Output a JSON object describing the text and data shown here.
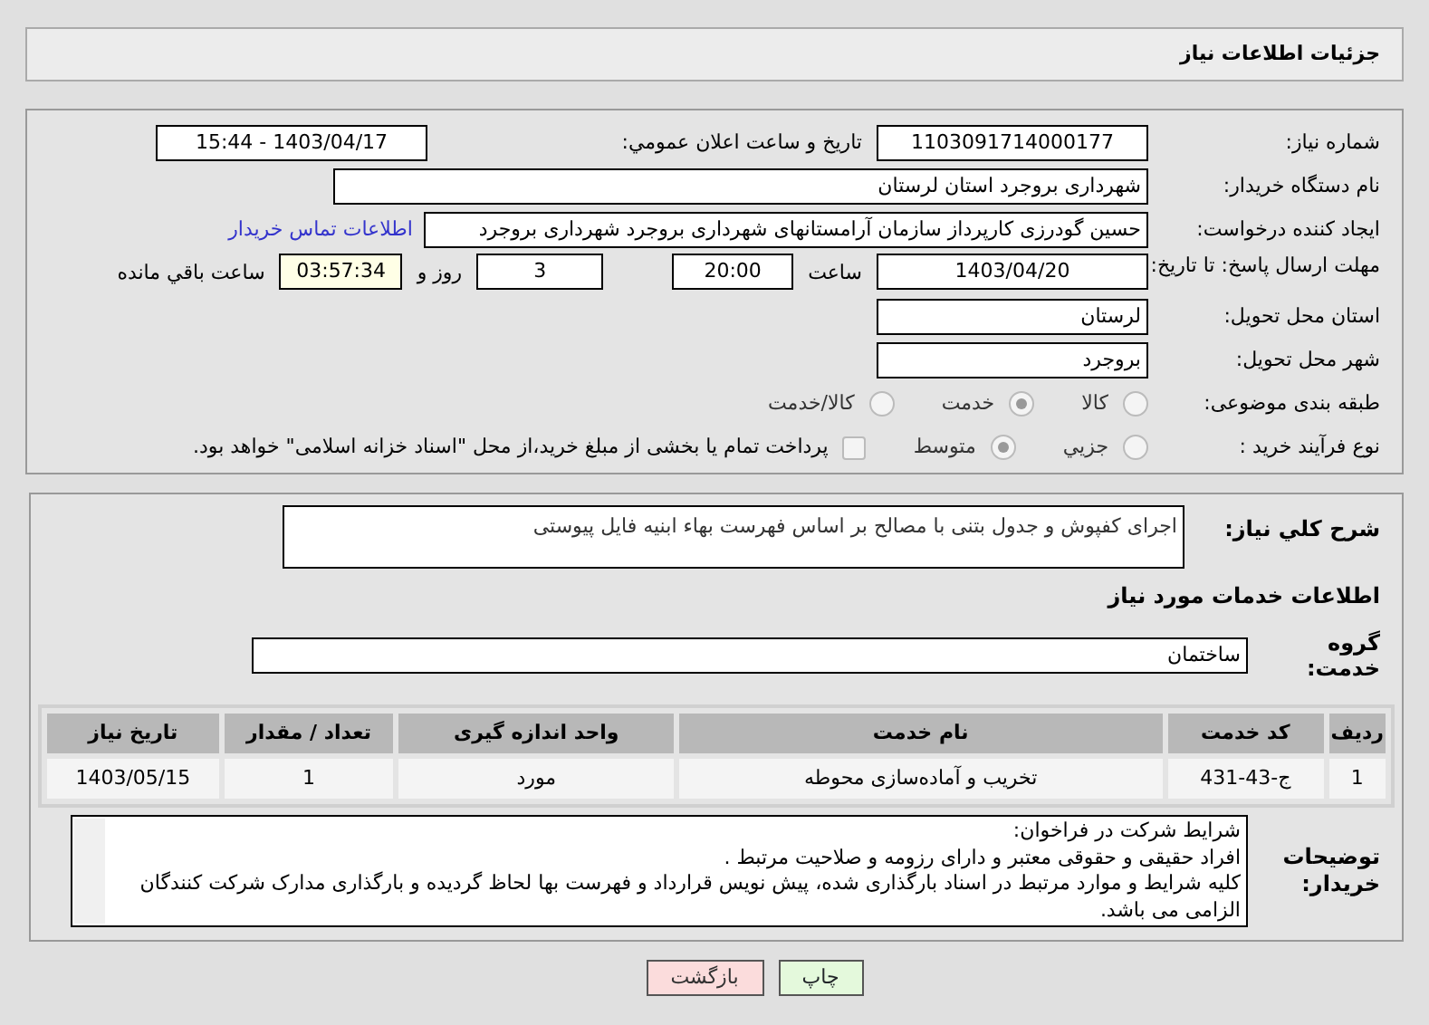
{
  "header": {
    "title": "جزئیات اطلاعات نیاز"
  },
  "need_number": {
    "label": "شماره نیاز:",
    "value": "1103091714000177"
  },
  "announce": {
    "label": "تاریخ و ساعت اعلان عمومي:",
    "value": "1403/04/17 - 15:44"
  },
  "buyer": {
    "label": "نام دستگاه خریدار:",
    "value": "شهرداری بروجرد استان لرستان"
  },
  "creator": {
    "label": "ایجاد کننده درخواست:",
    "value": "حسین گودرزی کارپرداز سازمان آرامستانهای شهرداری بروجرد شهرداری بروجرد",
    "link": "اطلاعات تماس خریدار"
  },
  "deadline": {
    "label": "مهلت ارسال پاسخ: تا تاریخ:",
    "date": "1403/04/20",
    "time_label": "ساعت",
    "time": "20:00",
    "days": "3",
    "days_label": "روز و",
    "remaining": "03:57:34",
    "remaining_label": "ساعت باقي مانده"
  },
  "province": {
    "label": "استان محل تحویل:",
    "value": "لرستان"
  },
  "city": {
    "label": "شهر محل تحویل:",
    "value": "بروجرد"
  },
  "category": {
    "label": "طبقه بندی موضوعی:",
    "options": [
      {
        "label": "کالا",
        "selected": false
      },
      {
        "label": "خدمت",
        "selected": true
      },
      {
        "label": "کالا/خدمت",
        "selected": false
      }
    ]
  },
  "process": {
    "label": "نوع فرآیند خرید :",
    "options": [
      {
        "label": "جزیي",
        "selected": false
      },
      {
        "label": "متوسط",
        "selected": true
      }
    ],
    "payment": {
      "label": "پرداخت تمام یا بخشی از مبلغ خرید،از محل \"اسناد خزانه اسلامی\" خواهد بود.",
      "checked": false
    }
  },
  "summary": {
    "label": "شرح کلي نياز:",
    "value": "اجرای کفپوش و جدول بتنی با مصالح بر اساس فهرست بهاء ابنیه فایل پیوستی"
  },
  "services_heading": "اطلاعات خدمات مورد نیاز",
  "service_group": {
    "label": "گروه خدمت:",
    "value": "ساختمان"
  },
  "table": {
    "columns": [
      "ردیف",
      "کد خدمت",
      "نام خدمت",
      "واحد اندازه گیری",
      "تعداد / مقدار",
      "تاریخ نیاز"
    ],
    "rows": [
      [
        "1",
        "ج-43-431",
        "تخریب و آماده‌سازی محوطه",
        "مورد",
        "1",
        "1403/05/15"
      ]
    ]
  },
  "notes": {
    "label": "توضیحات خریدار:",
    "lines": [
      "شرایط شرکت در فراخوان:",
      "افراد حقیقی و حقوقی معتبر و دارای رزومه و صلاحیت مرتبط .",
      "کلیه شرایط و موارد مرتبط در اسناد بارگذاری شده، پیش نویس قرارداد و فهرست بها لحاظ گردیده و بارگذاری مدارک شرکت کنندگان الزامی می باشد."
    ]
  },
  "buttons": [
    {
      "label": "چاپ",
      "kind": "print"
    },
    {
      "label": "بازگشت",
      "kind": "back"
    }
  ]
}
